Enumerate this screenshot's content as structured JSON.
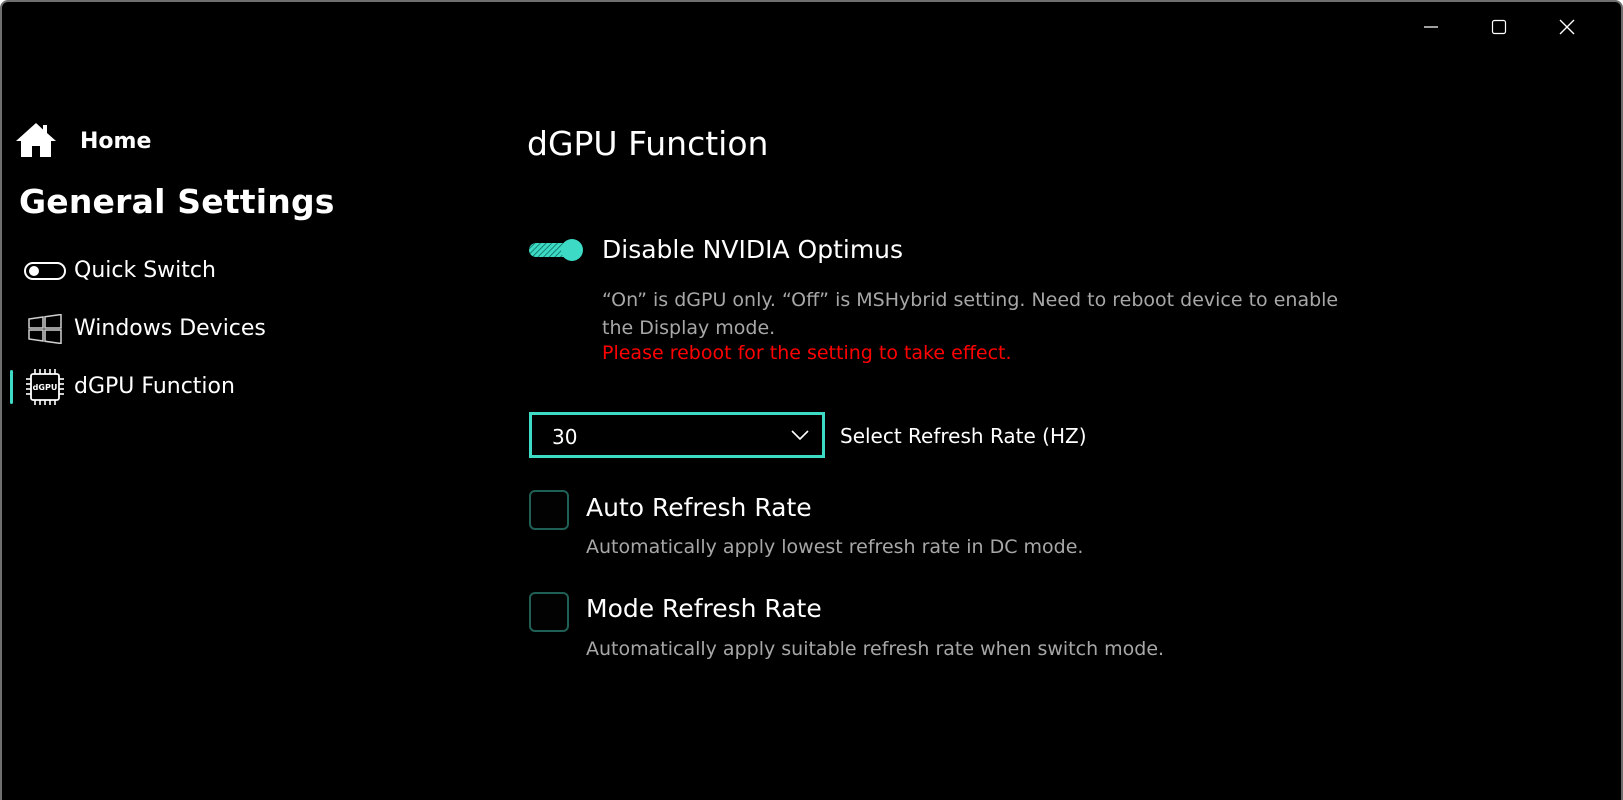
{
  "window": {
    "controls": {
      "minimize_icon": "minimize-icon",
      "maximize_icon": "maximize-icon",
      "close_icon": "close-icon"
    }
  },
  "sidebar": {
    "home": {
      "label": "Home",
      "icon": "home-icon"
    },
    "heading": "General Settings",
    "items": [
      {
        "label": "Quick Switch",
        "icon": "toggle-switch-icon"
      },
      {
        "label": "Windows Devices",
        "icon": "windows-logo-icon"
      },
      {
        "label": "dGPU Function",
        "icon": "dgpu-chip-icon",
        "selected": true,
        "chip_text": "dGPU"
      }
    ]
  },
  "main": {
    "title": "dGPU Function",
    "optimus": {
      "label": "Disable NVIDIA Optimus",
      "enabled": true,
      "description": "“On” is dGPU only. “Off” is MSHybrid setting. Need to reboot device to enable the Display mode.",
      "warning": "Please reboot for the setting to take effect."
    },
    "refresh_rate": {
      "value": "30",
      "label": "Select Refresh Rate (HZ)"
    },
    "auto_refresh": {
      "label": "Auto Refresh Rate",
      "description": "Automatically apply lowest refresh rate in DC mode.",
      "checked": false
    },
    "mode_refresh": {
      "label": "Mode Refresh Rate",
      "description": "Automatically apply suitable refresh rate when switch mode.",
      "checked": false
    }
  },
  "colors": {
    "accent": "#3ddbc5",
    "background": "#000000",
    "warning": "#ff0000",
    "secondary_text": "#a7a7a7",
    "checkbox_border": "#1f5f55"
  }
}
